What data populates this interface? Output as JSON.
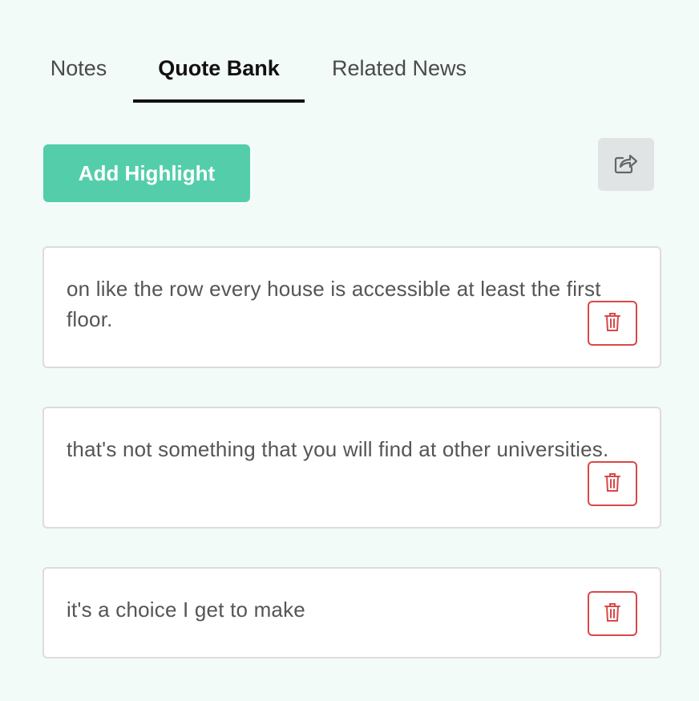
{
  "tabs": [
    {
      "label": "Notes",
      "active": false
    },
    {
      "label": "Quote Bank",
      "active": true
    },
    {
      "label": "Related News",
      "active": false
    }
  ],
  "toolbar": {
    "add_label": "Add Highlight",
    "share_icon": "share-icon",
    "accent_color": "#54ceaa"
  },
  "quotes": [
    {
      "text": "on like the row every house is accessible at least the first floor.",
      "delete_icon": "trash-icon"
    },
    {
      "text": "that's not something that you will find at other universities.",
      "delete_icon": "trash-icon"
    },
    {
      "text": "it's a choice I get to make",
      "delete_icon": "trash-icon"
    }
  ],
  "colors": {
    "background": "#f3fbf8",
    "delete": "#d94848",
    "share_bg": "#e1e4e5"
  }
}
